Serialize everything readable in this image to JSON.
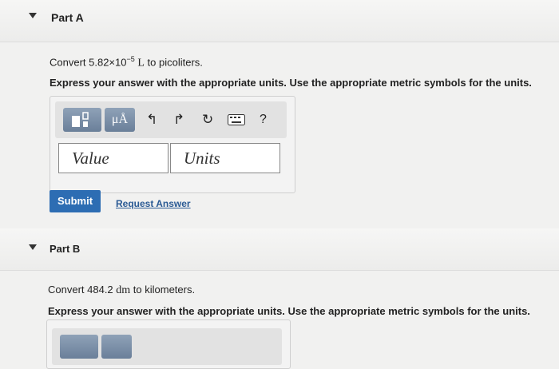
{
  "partA": {
    "title": "Part A",
    "prompt_prefix": "Convert 5.82×10",
    "prompt_exp": "−5",
    "prompt_unit": "L",
    "prompt_suffix": " to picoliters.",
    "instruction": "Express your answer with the appropriate units. Use the appropriate metric symbols for the units.",
    "toolbar": {
      "templates_icon": "templates-icon",
      "units_label": "μÅ",
      "undo_icon": "undo-icon",
      "redo_icon": "redo-icon",
      "reset_icon": "reset-icon",
      "keyboard_icon": "keyboard-icon",
      "help_label": "?"
    },
    "value_placeholder": "Value",
    "units_placeholder": "Units",
    "submit_label": "Submit",
    "request_answer_label": "Request Answer"
  },
  "partB": {
    "title": "Part B",
    "prompt_prefix": "Convert 484.2 ",
    "prompt_unit": "dm",
    "prompt_suffix": " to kilometers.",
    "instruction": "Express your answer with the appropriate units. Use the appropriate metric symbols for the units."
  },
  "colors": {
    "submit_bg": "#2d6db3",
    "link": "#2a5a94",
    "tool_button": "#7b8fa8"
  }
}
